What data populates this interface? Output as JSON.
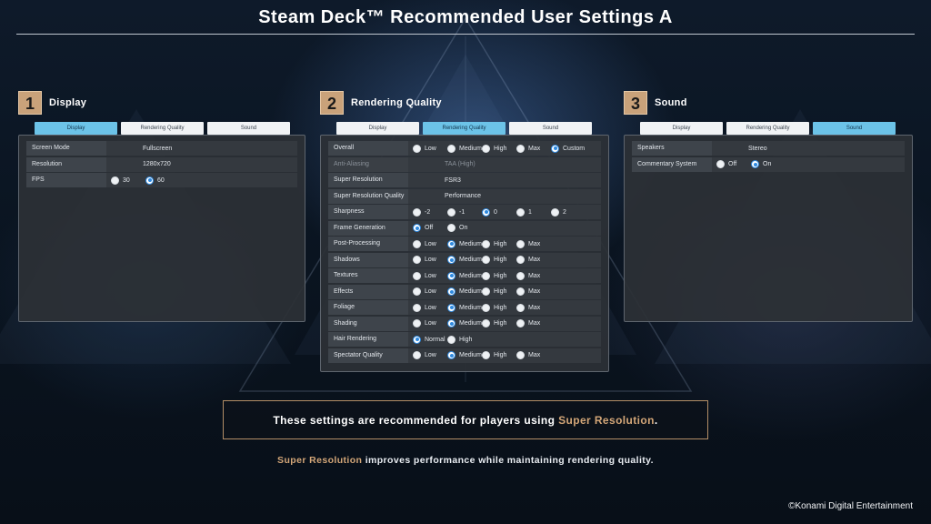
{
  "title": "Steam Deck™ Recommended User Settings A",
  "tabs": [
    "Display",
    "Rendering Quality",
    "Sound"
  ],
  "sections": {
    "display": {
      "number": "1",
      "label": "Display",
      "active_tab": 0
    },
    "rendering": {
      "number": "2",
      "label": "Rendering Quality",
      "active_tab": 1
    },
    "sound": {
      "number": "3",
      "label": "Sound",
      "active_tab": 2
    }
  },
  "display_settings": [
    {
      "label": "Screen Mode",
      "value": "Fullscreen"
    },
    {
      "label": "Resolution",
      "value": "1280x720"
    },
    {
      "label": "FPS",
      "options": [
        "30",
        "60"
      ],
      "selected": "60"
    }
  ],
  "rendering_settings": [
    {
      "label": "Overall",
      "options": [
        "Low",
        "Medium",
        "High",
        "Max",
        "Custom"
      ],
      "selected": "Custom"
    },
    {
      "label": "Anti-Aliasing",
      "value": "TAA (High)",
      "disabled": true
    },
    {
      "label": "Super Resolution",
      "value": "FSR3"
    },
    {
      "label": "Super Resolution Quality",
      "value": "Performance"
    },
    {
      "label": "Sharpness",
      "options": [
        "-2",
        "-1",
        "0",
        "1",
        "2"
      ],
      "selected": "0"
    },
    {
      "label": "Frame Generation",
      "options": [
        "Off",
        "On"
      ],
      "selected": "Off"
    },
    {
      "label": "Post-Processing",
      "options": [
        "Low",
        "Medium",
        "High",
        "Max"
      ],
      "selected": "Medium"
    },
    {
      "label": "Shadows",
      "options": [
        "Low",
        "Medium",
        "High",
        "Max"
      ],
      "selected": "Medium"
    },
    {
      "label": "Textures",
      "options": [
        "Low",
        "Medium",
        "High",
        "Max"
      ],
      "selected": "Medium"
    },
    {
      "label": "Effects",
      "options": [
        "Low",
        "Medium",
        "High",
        "Max"
      ],
      "selected": "Medium"
    },
    {
      "label": "Foliage",
      "options": [
        "Low",
        "Medium",
        "High",
        "Max"
      ],
      "selected": "Medium"
    },
    {
      "label": "Shading",
      "options": [
        "Low",
        "Medium",
        "High",
        "Max"
      ],
      "selected": "Medium"
    },
    {
      "label": "Hair Rendering",
      "options": [
        "Normal",
        "High"
      ],
      "selected": "Normal"
    },
    {
      "label": "Spectator Quality",
      "options": [
        "Low",
        "Medium",
        "High",
        "Max"
      ],
      "selected": "Medium"
    }
  ],
  "sound_settings": [
    {
      "label": "Speakers",
      "value": "Stereo"
    },
    {
      "label": "Commentary System",
      "options": [
        "Off",
        "On"
      ],
      "selected": "On"
    }
  ],
  "notice": {
    "before": "These settings are recommended for players using ",
    "highlight": "Super Resolution",
    "after": "."
  },
  "subline": {
    "highlight": "Super Resolution",
    "rest": " improves performance while maintaining rendering quality."
  },
  "copyright": "©Konami Digital Entertainment",
  "colors": {
    "accent_gold": "#c9a27a",
    "active_tab": "#6cc3e8",
    "radio_selected": "#2f8ae0"
  }
}
